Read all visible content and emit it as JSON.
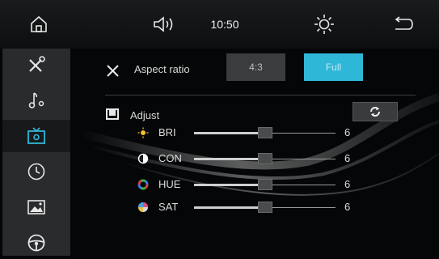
{
  "topbar": {
    "home_icon": "home-icon",
    "volume_icon": "speaker-icon",
    "time": "10:50",
    "brightness_icon": "sun-icon",
    "back_icon": "back-arrow-icon"
  },
  "sidebar": {
    "items": [
      {
        "icon": "tools-icon",
        "active": false
      },
      {
        "icon": "music-note-icon",
        "active": false
      },
      {
        "icon": "tv-icon",
        "active": true
      },
      {
        "icon": "clock-icon",
        "active": false
      },
      {
        "icon": "picture-icon",
        "active": false
      },
      {
        "icon": "steering-wheel-icon",
        "active": false
      }
    ]
  },
  "aspect_ratio": {
    "label": "Aspect ratio",
    "option_4_3": "4:3",
    "option_full": "Full",
    "selected": "Full"
  },
  "adjust": {
    "label": "Adjust",
    "reset_icon": "reset-icon",
    "sliders": [
      {
        "label": "BRI",
        "value": "6",
        "level": 0.5
      },
      {
        "label": "CON",
        "value": "6",
        "level": 0.5
      },
      {
        "label": "HUE",
        "value": "6",
        "level": 0.5
      },
      {
        "label": "SAT",
        "value": "6",
        "level": 0.5
      }
    ]
  },
  "colors": {
    "accent": "#2fb7d8",
    "sidebar": "#2a2b2d",
    "sidebar_active": "#18191a"
  }
}
